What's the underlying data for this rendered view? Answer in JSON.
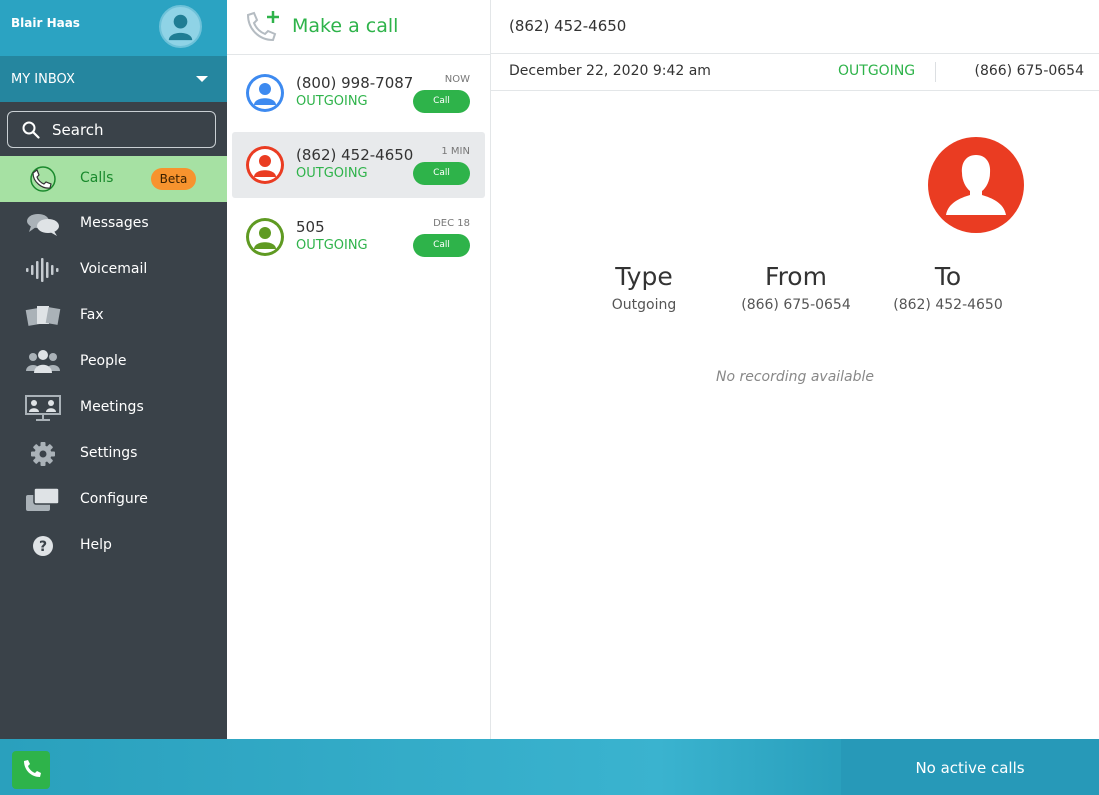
{
  "sidebar": {
    "user_name": "Blair Haas",
    "inbox_label": "MY INBOX",
    "search_placeholder": "Search",
    "items": [
      {
        "label": "Calls",
        "icon": "phone-ring-icon",
        "badge": "Beta",
        "active": true
      },
      {
        "label": "Messages",
        "icon": "chat-bubbles-icon"
      },
      {
        "label": "Voicemail",
        "icon": "voicemail-wave-icon"
      },
      {
        "label": "Fax",
        "icon": "fax-icon"
      },
      {
        "label": "People",
        "icon": "people-icon"
      },
      {
        "label": "Meetings",
        "icon": "meetings-icon"
      },
      {
        "label": "Settings",
        "icon": "gear-icon"
      },
      {
        "label": "Configure",
        "icon": "configure-icon"
      },
      {
        "label": "Help",
        "icon": "help-icon"
      }
    ]
  },
  "call_list": {
    "make_call_label": "Make a call",
    "items": [
      {
        "number": "(800) 998-7087",
        "status": "OUTGOING",
        "time": "NOW",
        "call_label": "Call",
        "avatar_color": "#3d8af0"
      },
      {
        "number": "(862) 452-4650",
        "status": "OUTGOING",
        "time": "1 MIN",
        "call_label": "Call",
        "avatar_color": "#ea3c22",
        "selected": true
      },
      {
        "number": "505",
        "status": "OUTGOING",
        "time": "DEC 18",
        "call_label": "Call",
        "avatar_color": "#5f9a22"
      }
    ]
  },
  "detail": {
    "number": "(862) 452-4650",
    "date": "December 22, 2020 9:42 am",
    "direction": "OUTGOING",
    "from_number": "(866) 675-0654",
    "avatar_color": "#ea3c22",
    "columns": [
      {
        "head": "Type",
        "value": "Outgoing"
      },
      {
        "head": "From",
        "value": "(866) 675-0654"
      },
      {
        "head": "To",
        "value": "(862) 452-4650"
      }
    ],
    "no_recording": "No recording available"
  },
  "bottom": {
    "status": "No active calls"
  },
  "colors": {
    "accent_green": "#2eb34a",
    "header_teal": "#2ba3c2",
    "sidebar_dark": "#3a4249"
  }
}
